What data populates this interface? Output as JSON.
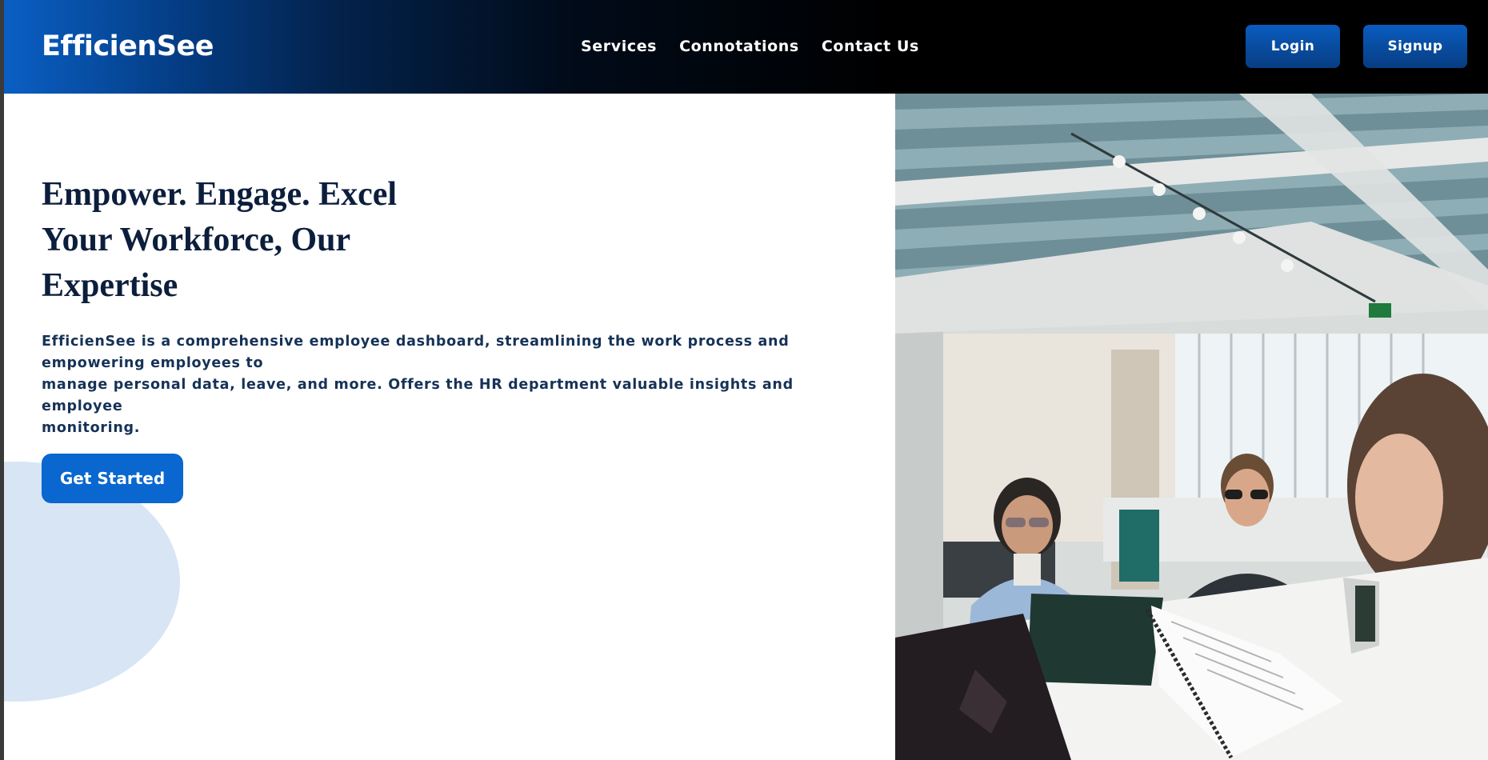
{
  "brand": {
    "name": "EfficienSee"
  },
  "nav": {
    "items": [
      {
        "label": "Services"
      },
      {
        "label": "Connotations"
      },
      {
        "label": "Contact Us"
      }
    ]
  },
  "auth": {
    "login_label": "Login",
    "signup_label": "Signup"
  },
  "hero": {
    "headline_lines": [
      "Empower. Engage. Excel",
      "Your Workforce, Our",
      "Expertise"
    ],
    "description_lines": [
      "EfficienSee is a comprehensive employee dashboard, streamlining the work process and",
      "empowering employees to",
      "manage personal data, leave, and more. Offers the HR department valuable insights and employee",
      "monitoring."
    ],
    "cta_label": "Get Started"
  },
  "colors": {
    "brand_blue": "#0967cf",
    "heading_navy": "#0c1e3c",
    "accent_light_blue": "#d7e5f4"
  }
}
